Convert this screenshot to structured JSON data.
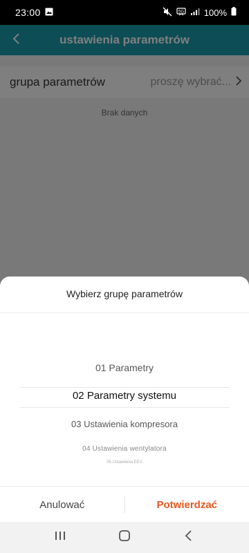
{
  "status_bar": {
    "time": "23:00",
    "battery": "100%",
    "icons": [
      "image-icon",
      "mute-icon",
      "data-icon",
      "signal-icon",
      "battery-icon"
    ]
  },
  "header": {
    "title": "ustawienia parametrów",
    "back_icon": "chevron-left-icon",
    "color": "#1a9aab"
  },
  "param_row": {
    "label": "grupa parametrów",
    "value": "proszę wybrać...",
    "icon": "chevron-right-icon"
  },
  "no_data": "Brak danych",
  "picker_sheet": {
    "title": "Wybierz grupę parametrów",
    "items": [
      "01 Parametry",
      "02 Parametry systemu",
      "03 Ustawienia kompresora",
      "04 Ustawienia wentylatora",
      "05 Ustawienia EEV"
    ],
    "selected_index": 1,
    "cancel_label": "Anulować",
    "confirm_label": "Potwierdzać",
    "confirm_color": "#e8561c"
  },
  "nav_bar": {
    "icons": [
      "recent-apps-icon",
      "home-icon",
      "back-icon"
    ]
  }
}
